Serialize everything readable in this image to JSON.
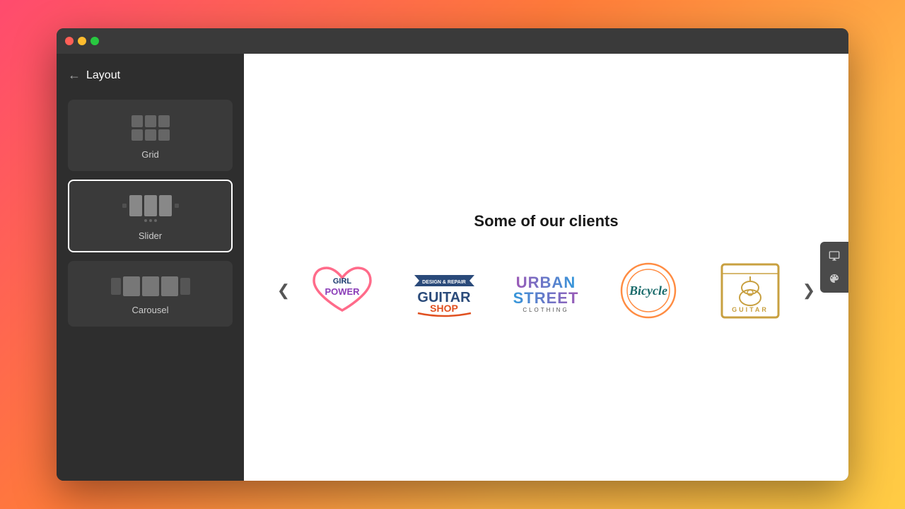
{
  "window": {
    "titlebar": {
      "traffic_lights": [
        "red",
        "yellow",
        "green"
      ]
    }
  },
  "sidebar": {
    "back_label": "←",
    "title": "Layout",
    "cards": [
      {
        "id": "grid",
        "label": "Grid",
        "active": false
      },
      {
        "id": "slider",
        "label": "Slider",
        "active": true
      },
      {
        "id": "carousel",
        "label": "Carousel",
        "active": false
      }
    ]
  },
  "main": {
    "clients_title": "Some of our clients",
    "arrow_left": "❮",
    "arrow_right": "❯",
    "logos": [
      {
        "id": "girl-power",
        "alt": "Girl Power"
      },
      {
        "id": "guitar-shop",
        "alt": "Guitar Shop"
      },
      {
        "id": "urban-street",
        "alt": "Urban Street Clothing"
      },
      {
        "id": "bicycle",
        "alt": "Bicycle"
      },
      {
        "id": "guitar-box",
        "alt": "Guitar Box"
      }
    ]
  }
}
